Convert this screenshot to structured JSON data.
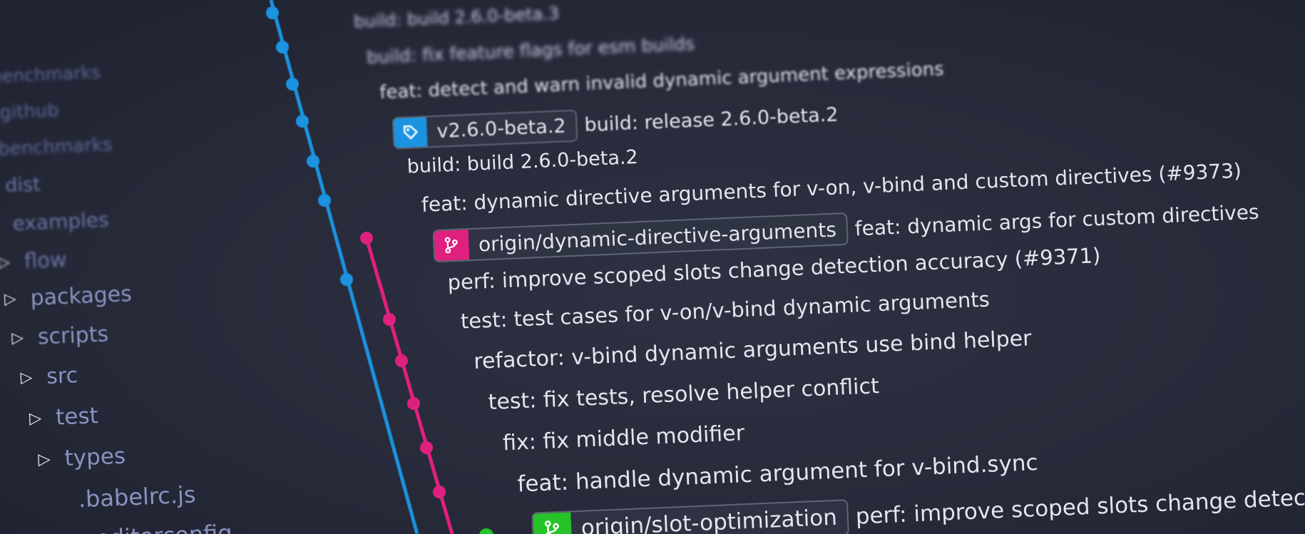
{
  "colors": {
    "background": "#262a39",
    "branch_blue": "#1b93e0",
    "branch_pink": "#e0207e",
    "branch_green": "#25c22a",
    "tree_text": "#8a92c0",
    "commit_text": "#e4e6ee"
  },
  "file_tree": [
    {
      "name": "benchmarks",
      "expandable": false
    },
    {
      "name": ".github",
      "expandable": false
    },
    {
      "name": "benchmarks",
      "expandable": false
    },
    {
      "name": "dist",
      "expandable": false
    },
    {
      "name": "examples",
      "expandable": false
    },
    {
      "name": "flow",
      "expandable": true
    },
    {
      "name": "packages",
      "expandable": true
    },
    {
      "name": "scripts",
      "expandable": true
    },
    {
      "name": "src",
      "expandable": true
    },
    {
      "name": "test",
      "expandable": true
    },
    {
      "name": "types",
      "expandable": true
    },
    {
      "name": ".babelrc.js",
      "expandable": false
    },
    {
      "name": ".editorconfig",
      "expandable": false
    }
  ],
  "tree_icons": {
    "expand": "caret-right-icon"
  },
  "commits": [
    {
      "message": "build: build 2.6.0-beta.3"
    },
    {
      "message": "build: fix feature flags for esm builds"
    },
    {
      "message": "feat: detect and warn invalid dynamic argument expressions"
    },
    {
      "ref": "v2.6.0-beta.2",
      "ref_kind": "tag",
      "ref_icon": "tag-icon",
      "message": "build: release 2.6.0-beta.2"
    },
    {
      "message": "build: build 2.6.0-beta.2"
    },
    {
      "message": "feat: dynamic directive arguments for v-on, v-bind and custom directives (#9373)"
    },
    {
      "ref": "origin/dynamic-directive-arguments",
      "ref_kind": "branch",
      "ref_icon": "branch-icon",
      "message": "feat: dynamic args for custom directives"
    },
    {
      "message": "perf: improve scoped slots change detection accuracy (#9371)"
    },
    {
      "message": "test: test cases for v-on/v-bind dynamic arguments"
    },
    {
      "message": "refactor: v-bind dynamic arguments use bind helper"
    },
    {
      "message": "test: fix tests, resolve helper conflict"
    },
    {
      "message": "fix: fix middle modifier"
    },
    {
      "message": "feat: handle dynamic argument for v-bind.sync"
    },
    {
      "ref": "origin/slot-optimization",
      "ref_kind": "branch",
      "ref_icon": "branch-icon",
      "message": "perf: improve scoped slots change detection"
    }
  ]
}
